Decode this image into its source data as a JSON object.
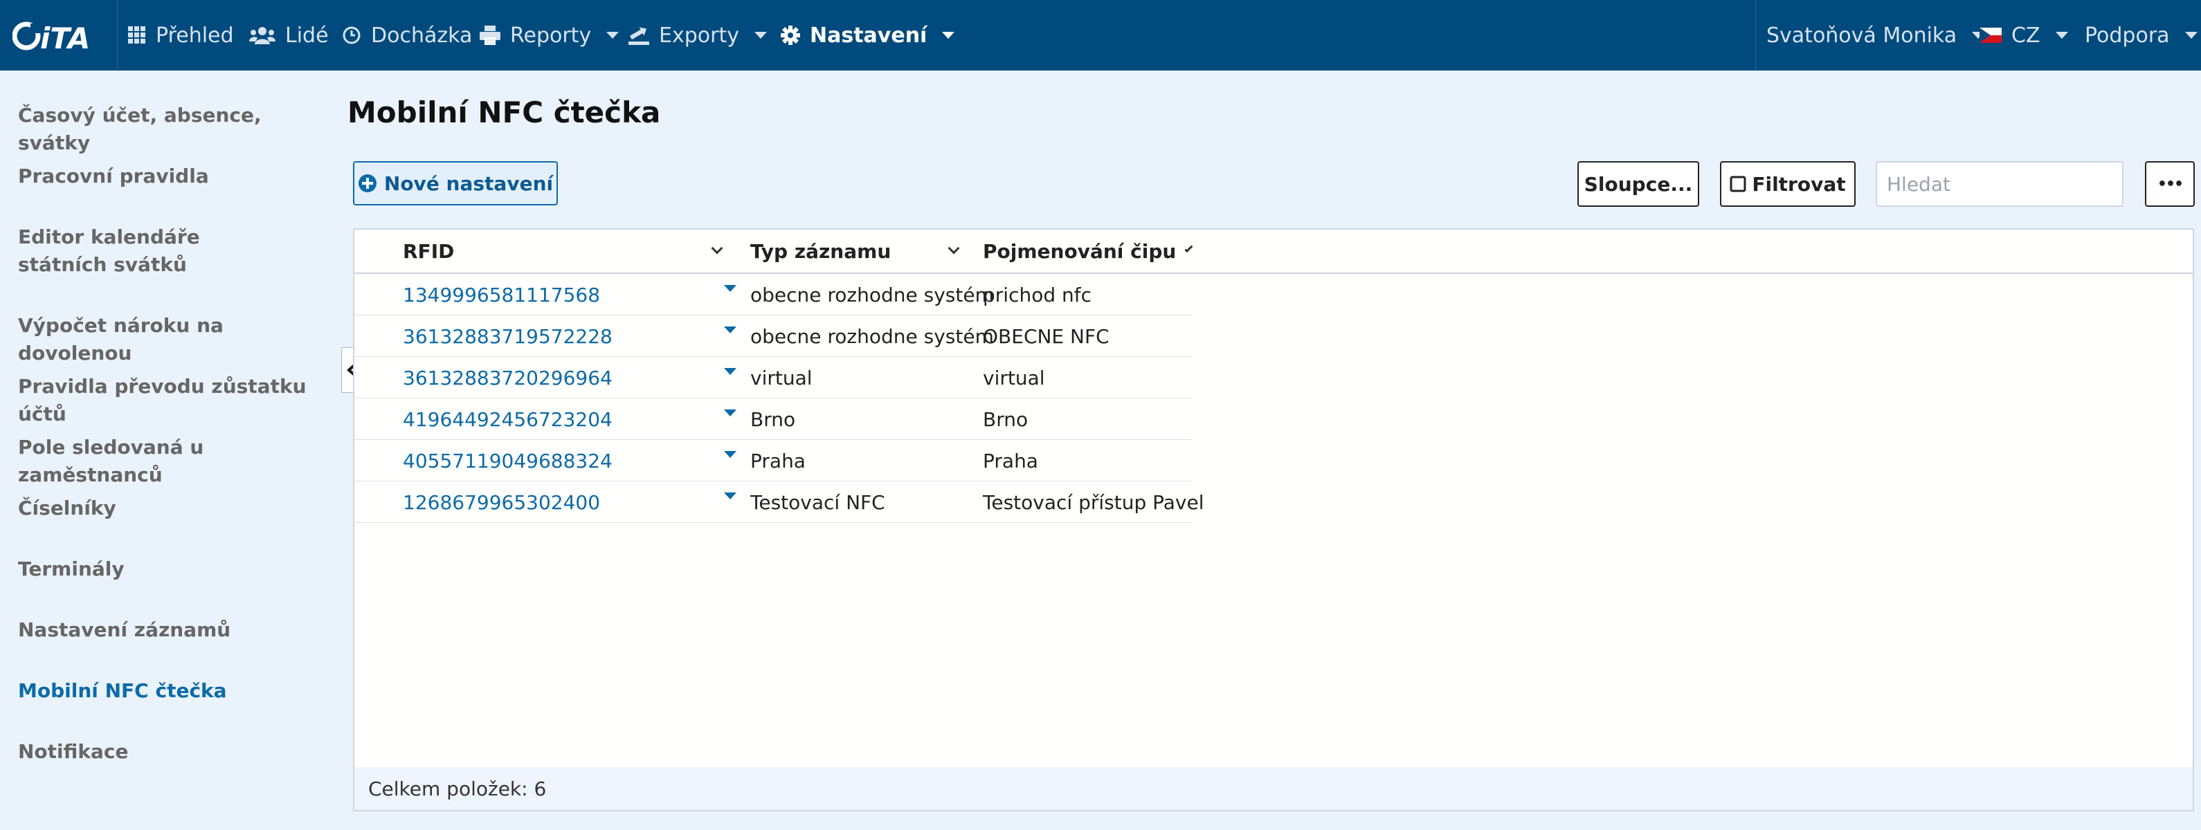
{
  "nav": {
    "logo_text": "iTA",
    "items": [
      {
        "label": "Přehled",
        "icon": "grid-icon"
      },
      {
        "label": "Lidé",
        "icon": "users-icon"
      },
      {
        "label": "Docházka",
        "icon": "clock-icon"
      },
      {
        "label": "Reporty",
        "icon": "print-icon"
      },
      {
        "label": "Exporty",
        "icon": "export-icon"
      },
      {
        "label": "Nastavení",
        "icon": "gear-icon"
      }
    ],
    "user": "Svatoňová Monika",
    "language": "CZ",
    "support": "Podpora"
  },
  "sidebar": {
    "items": [
      {
        "label": "Časový účet, absence, svátky"
      },
      {
        "label": "Pracovní pravidla"
      },
      {
        "label": "Editor kalendáře státních svátků"
      },
      {
        "label": "Výpočet nároku na dovolenou"
      },
      {
        "label": "Pravidla převodu zůstatku účtů"
      },
      {
        "label": "Pole sledovaná u zaměstnanců"
      },
      {
        "label": "Číselníky"
      },
      {
        "label": "Terminály"
      },
      {
        "label": "Nastavení záznamů"
      },
      {
        "label": "Mobilní NFC čtečka"
      },
      {
        "label": "Notifikace"
      }
    ],
    "active_index": 9
  },
  "page": {
    "title": "Mobilní NFC čtečka",
    "new_button": "Nové nastavení",
    "columns_button": "Sloupce...",
    "filter_button": "Filtrovat",
    "search_placeholder": "Hledat",
    "more_button": "•••"
  },
  "table": {
    "columns": [
      "RFID",
      "Typ záznamu",
      "Pojmenování čipu"
    ],
    "rows": [
      {
        "rfid": "1349996581117568",
        "typ": "obecne rozhodne systém",
        "nazev": "prichod nfc"
      },
      {
        "rfid": "36132883719572228",
        "typ": "obecne rozhodne systém",
        "nazev": "OBECNE NFC"
      },
      {
        "rfid": "36132883720296964",
        "typ": "virtual",
        "nazev": "virtual"
      },
      {
        "rfid": "41964492456723204",
        "typ": "Brno",
        "nazev": "Brno"
      },
      {
        "rfid": "40557119049688324",
        "typ": "Praha",
        "nazev": "Praha"
      },
      {
        "rfid": "1268679965302400",
        "typ": "Testovací NFC",
        "nazev": "Testovací přístup Pavel"
      }
    ],
    "footer": "Celkem položek: 6"
  },
  "colors": {
    "nav_bg": "#014a7e",
    "accent": "#0d6aa8",
    "page_bg": "#eaf3fb"
  }
}
